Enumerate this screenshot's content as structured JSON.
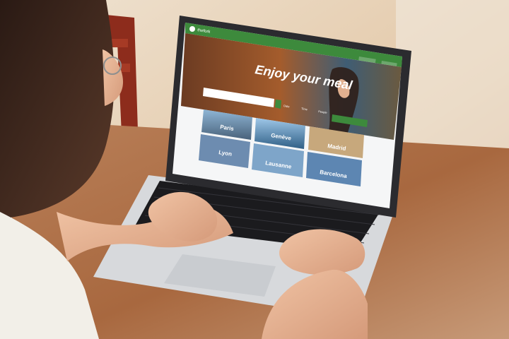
{
  "site": {
    "logo_text": "thefork",
    "location_label": "",
    "login_label": "",
    "help_label": ""
  },
  "hero": {
    "headline": "Enjoy your meal",
    "search_placeholder": "",
    "date_label": "Date",
    "time_label": "Time",
    "people_label": "People",
    "cta_label": ""
  },
  "cities": [
    {
      "name": "Paris"
    },
    {
      "name": "Genève"
    },
    {
      "name": "Madrid"
    },
    {
      "name": "Lyon"
    },
    {
      "name": "Lausanne"
    },
    {
      "name": "Barcelona"
    }
  ],
  "colors": {
    "brand_green": "#3d8a3c",
    "screen_bg": "#f5f6f7",
    "laptop_body": "#d8dadd",
    "keyboard": "#1c1c1f",
    "table_wood": "#b77b52",
    "chip_bg": "#4d6e8a"
  }
}
